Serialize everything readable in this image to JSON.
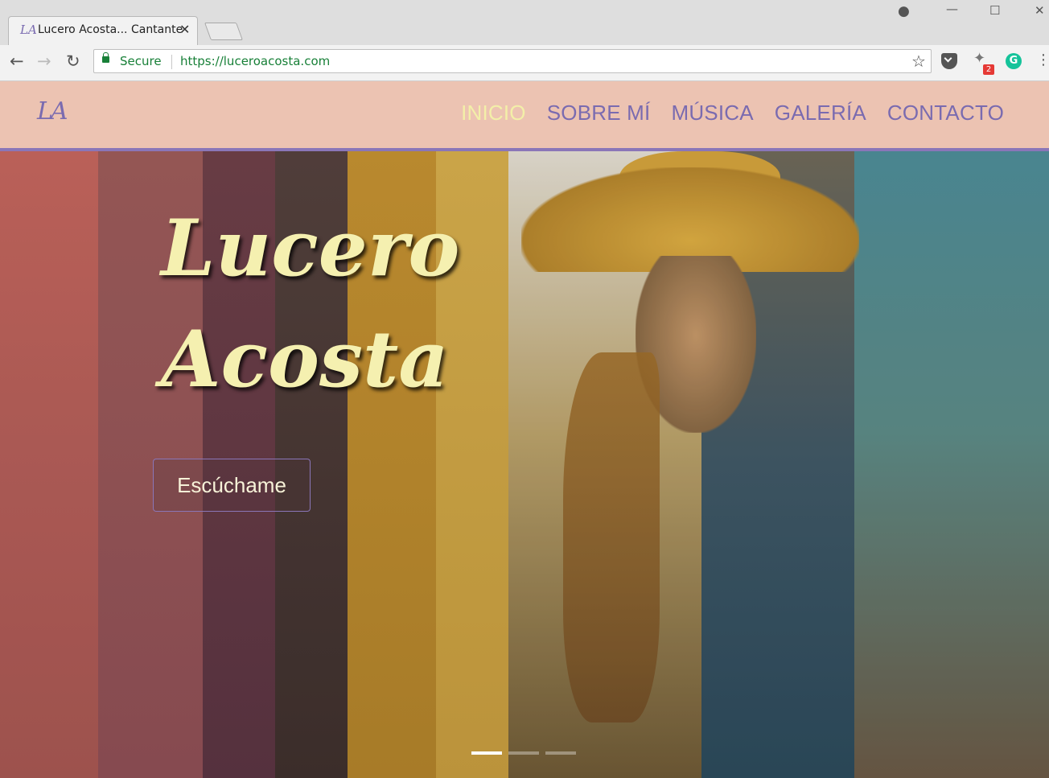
{
  "browser": {
    "tab": {
      "favicon": "LA",
      "title": "Lucero Acosta... Cantante",
      "close_glyph": "✕"
    },
    "window_controls": {
      "profile_glyph": "●",
      "minimize_glyph": "—",
      "maximize_glyph": "☐",
      "close_glyph": "✕"
    },
    "toolbar": {
      "back_glyph": "←",
      "forward_glyph": "→",
      "reload_glyph": "↻",
      "secure_label": "Secure",
      "url": "https://luceroacosta.com",
      "bookmark_glyph": "☆",
      "extension_badge": "2",
      "grammarly_glyph": "G",
      "menu_glyph": "⋮"
    }
  },
  "site": {
    "logo": "LA",
    "nav": [
      {
        "label": "INICIO",
        "active": true
      },
      {
        "label": "SOBRE MÍ",
        "active": false
      },
      {
        "label": "MÚSICA",
        "active": false
      },
      {
        "label": "GALERÍA",
        "active": false
      },
      {
        "label": "CONTACTO",
        "active": false
      }
    ],
    "hero": {
      "title_line1": "Lucero",
      "title_line2": "Acosta",
      "cta_label": "Escúchame",
      "slide_count": 3,
      "active_slide": 1
    },
    "colors": {
      "header_bg": "#ecc3b2",
      "nav_text": "#7a6bb0",
      "nav_active": "#f3efa8",
      "accent_border": "#8a76b8",
      "title_text": "#f5f0b0",
      "secure_green": "#188038"
    }
  }
}
